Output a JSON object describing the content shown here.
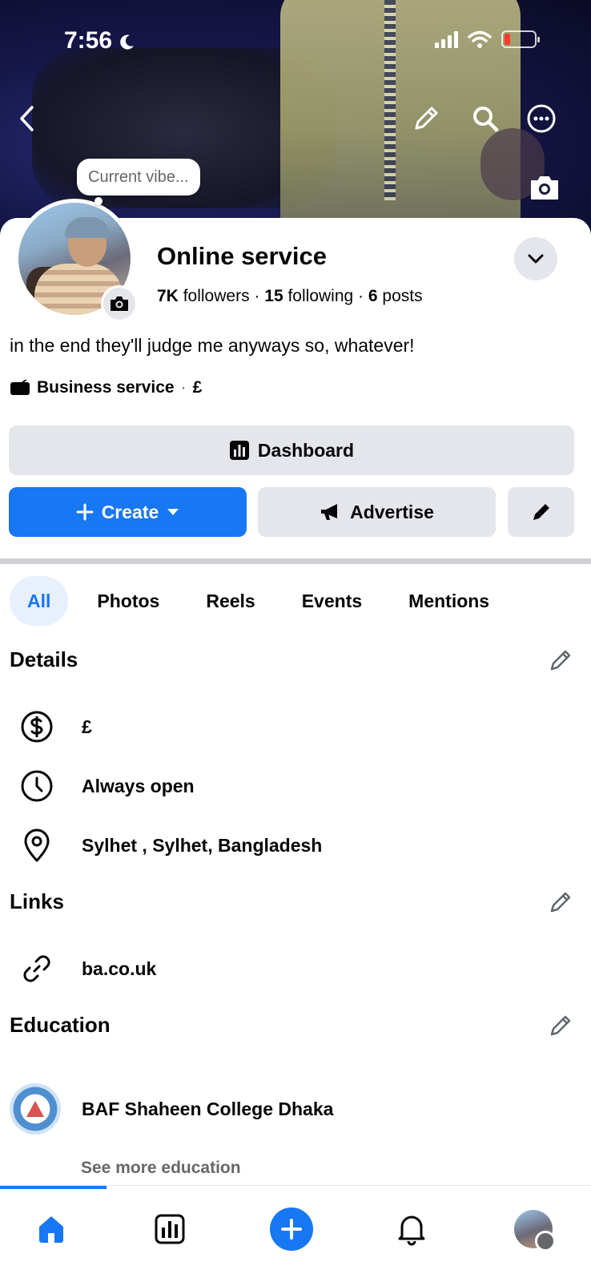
{
  "status_bar": {
    "time": "7:56"
  },
  "cover": {
    "bubble_text": "Current vibe..."
  },
  "profile": {
    "name": "Online service",
    "followers_count": "7K",
    "followers_label": "followers",
    "following_count": "15",
    "following_label": "following",
    "posts_count": "6",
    "posts_label": "posts",
    "separator": "·",
    "bio": "in the end they'll judge me anyways so, whatever!",
    "category": "Business service",
    "price": "£"
  },
  "buttons": {
    "dashboard": "Dashboard",
    "create": "Create",
    "advertise": "Advertise"
  },
  "tabs": [
    "All",
    "Photos",
    "Reels",
    "Events",
    "Mentions"
  ],
  "details": {
    "title": "Details",
    "price": "£",
    "hours": "Always open",
    "location": "Sylhet , Sylhet, Bangladesh"
  },
  "links": {
    "title": "Links",
    "url": "ba.co.uk"
  },
  "education": {
    "title": "Education",
    "school": "BAF Shaheen College Dhaka",
    "see_more": "See more education"
  },
  "colors": {
    "accent": "#1877f2",
    "button_gray": "#e4e6eb",
    "active_tab_bg": "#e7f0fc",
    "text_secondary": "#65676b"
  },
  "icons": [
    "back-icon",
    "pencil-icon",
    "search-icon",
    "more-icon",
    "camera-icon",
    "chevron-down-icon",
    "dashboard-icon",
    "plus-icon",
    "caret-down-icon",
    "megaphone-icon",
    "dollar-icon",
    "clock-icon",
    "location-pin-icon",
    "link-icon",
    "home-icon",
    "bell-icon"
  ]
}
